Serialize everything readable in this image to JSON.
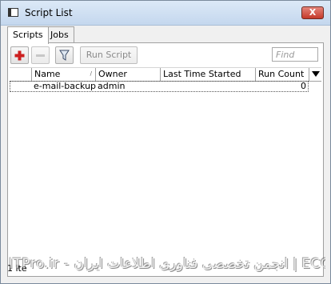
{
  "window": {
    "title": "Script List",
    "close_label": "X"
  },
  "tabs": [
    {
      "label": "Scripts",
      "active": true
    },
    {
      "label": "Jobs",
      "active": false
    }
  ],
  "toolbar": {
    "add_icon": "plus-icon",
    "remove_icon": "minus-icon",
    "filter_icon": "filter-icon",
    "run_label": "Run Script",
    "find_placeholder": "Find"
  },
  "table": {
    "columns": [
      "Name",
      "Owner",
      "Last Time Started",
      "Run Count"
    ],
    "rows": [
      {
        "name": "e-mail-backup",
        "owner": "admin",
        "last_started": "",
        "run_count": "0"
      }
    ]
  },
  "status": {
    "text": "1 ite"
  },
  "watermark": {
    "text": "ITPro.ir - انجمن تخصصی فناوری اطلاعات ایران  |  ECGINSRO.COM"
  },
  "colors": {
    "add_icon": "#cc1f1f",
    "close_button": "#c5392a",
    "title_bar": "#c4d7ee"
  }
}
